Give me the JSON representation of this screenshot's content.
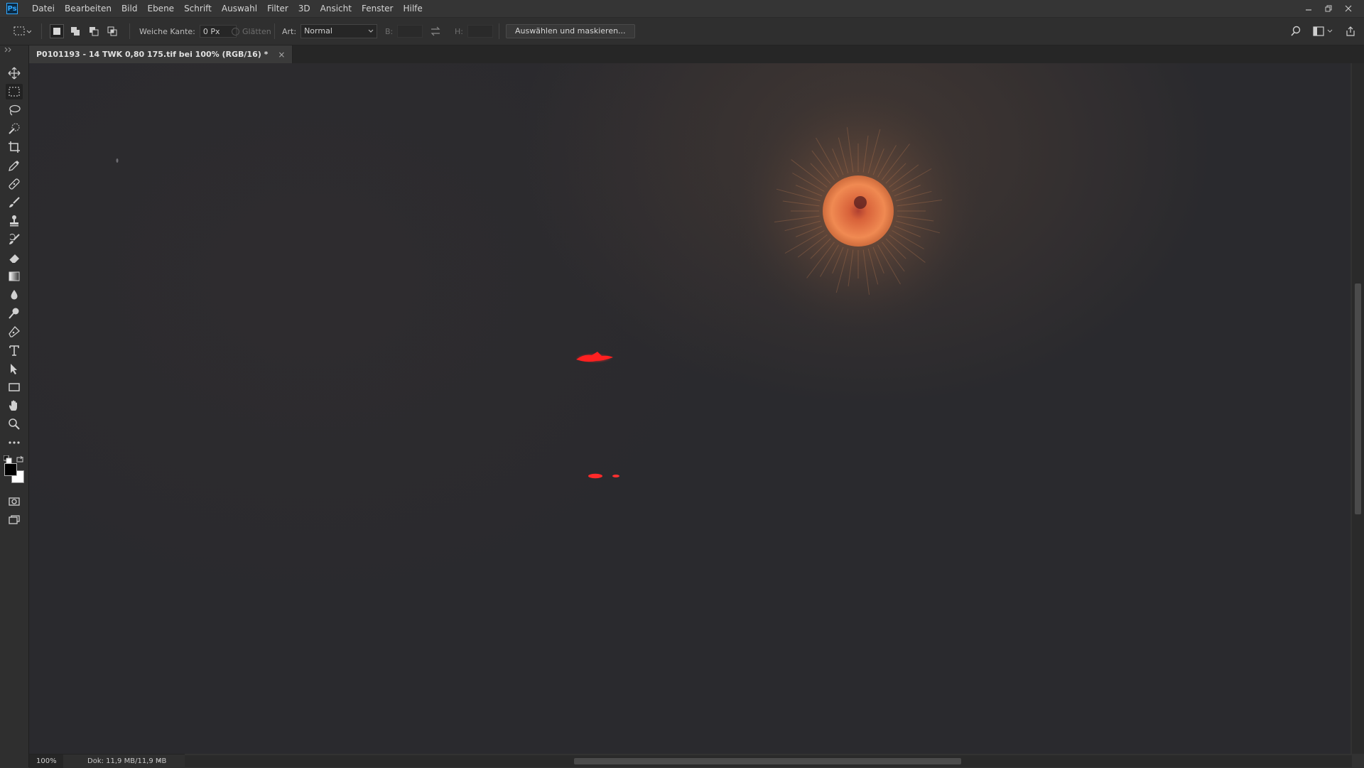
{
  "app": {
    "logo_text": "Ps"
  },
  "menu": [
    "Datei",
    "Bearbeiten",
    "Bild",
    "Ebene",
    "Schrift",
    "Auswahl",
    "Filter",
    "3D",
    "Ansicht",
    "Fenster",
    "Hilfe"
  ],
  "options": {
    "feather_label": "Weiche Kante:",
    "feather_value": "0 Px",
    "antialias_label": "Glätten",
    "style_label": "Art:",
    "style_value": "Normal",
    "width_label": "B:",
    "height_label": "H:",
    "select_mask_label": "Auswählen und maskieren..."
  },
  "tools": [
    "move",
    "rectangular-marquee",
    "lasso",
    "quick-selection",
    "crop",
    "eyedropper",
    "spot-healing",
    "brush",
    "clone-stamp",
    "history-brush",
    "eraser",
    "gradient",
    "blur",
    "dodge",
    "pen",
    "type",
    "path-selection",
    "rectangle",
    "hand",
    "zoom",
    "more"
  ],
  "colors": {
    "foreground": "#000000",
    "background": "#ffffff",
    "accent": "#31a8ff"
  },
  "document": {
    "tab_title": "P0101193 - 14 TWK  0,80 175.tif bei 100% (RGB/16) *",
    "close_glyph": "×"
  },
  "status": {
    "zoom": "100%",
    "doc_info": "Dok: 11,9 MB/11,9 MB",
    "arrow": "›"
  }
}
